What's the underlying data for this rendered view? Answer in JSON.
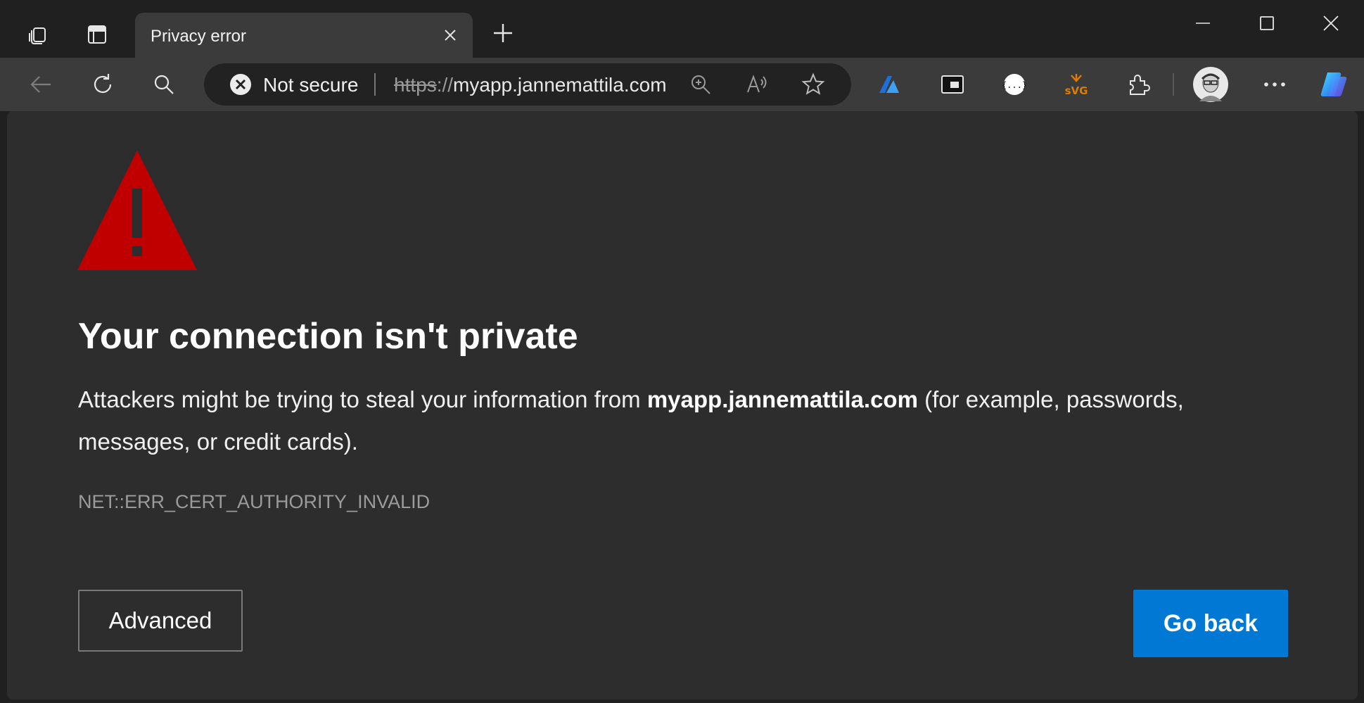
{
  "browser": {
    "tab": {
      "title": "Privacy error"
    },
    "security_label": "Not secure",
    "url": {
      "scheme": "https",
      "separator": "://",
      "host": "myapp.jannemattila.com"
    },
    "icons": {
      "titlebar": [
        "workspaces-icon",
        "vertical-tabs-icon",
        "close-tab-icon",
        "new-tab-icon"
      ],
      "window": [
        "minimize-icon",
        "maximize-icon",
        "close-window-icon"
      ],
      "nav": [
        "back-icon",
        "refresh-icon",
        "search-icon"
      ],
      "omnibox": [
        "not-secure-icon",
        "zoom-icon",
        "read-aloud-icon",
        "favorite-star-icon"
      ],
      "extensions": [
        "azure-extension-icon",
        "picture-in-picture-icon",
        "json-extension-icon",
        "svg-extension-icon",
        "extensions-puzzle-icon",
        "profile-avatar",
        "more-menu-icon",
        "copilot-icon"
      ]
    },
    "colors": {
      "frame": "#202020",
      "toolbar": "#3b3b3b",
      "omnibox": "#222222",
      "page": "#2d2d2d"
    }
  },
  "error_page": {
    "heading": "Your connection isn't private",
    "description_prefix": "Attackers might be trying to steal your information from ",
    "description_host": "myapp.jannemattila.com",
    "description_suffix": " (for example, passwords, messages, or credit cards).",
    "error_code": "NET::ERR_CERT_AUTHORITY_INVALID",
    "advanced_label": "Advanced",
    "go_back_label": "Go back",
    "icon": "warning-triangle-icon",
    "colors": {
      "warning": "#c00000",
      "primary_button": "#0078d4",
      "error_code_text": "#9b9b9b"
    }
  }
}
